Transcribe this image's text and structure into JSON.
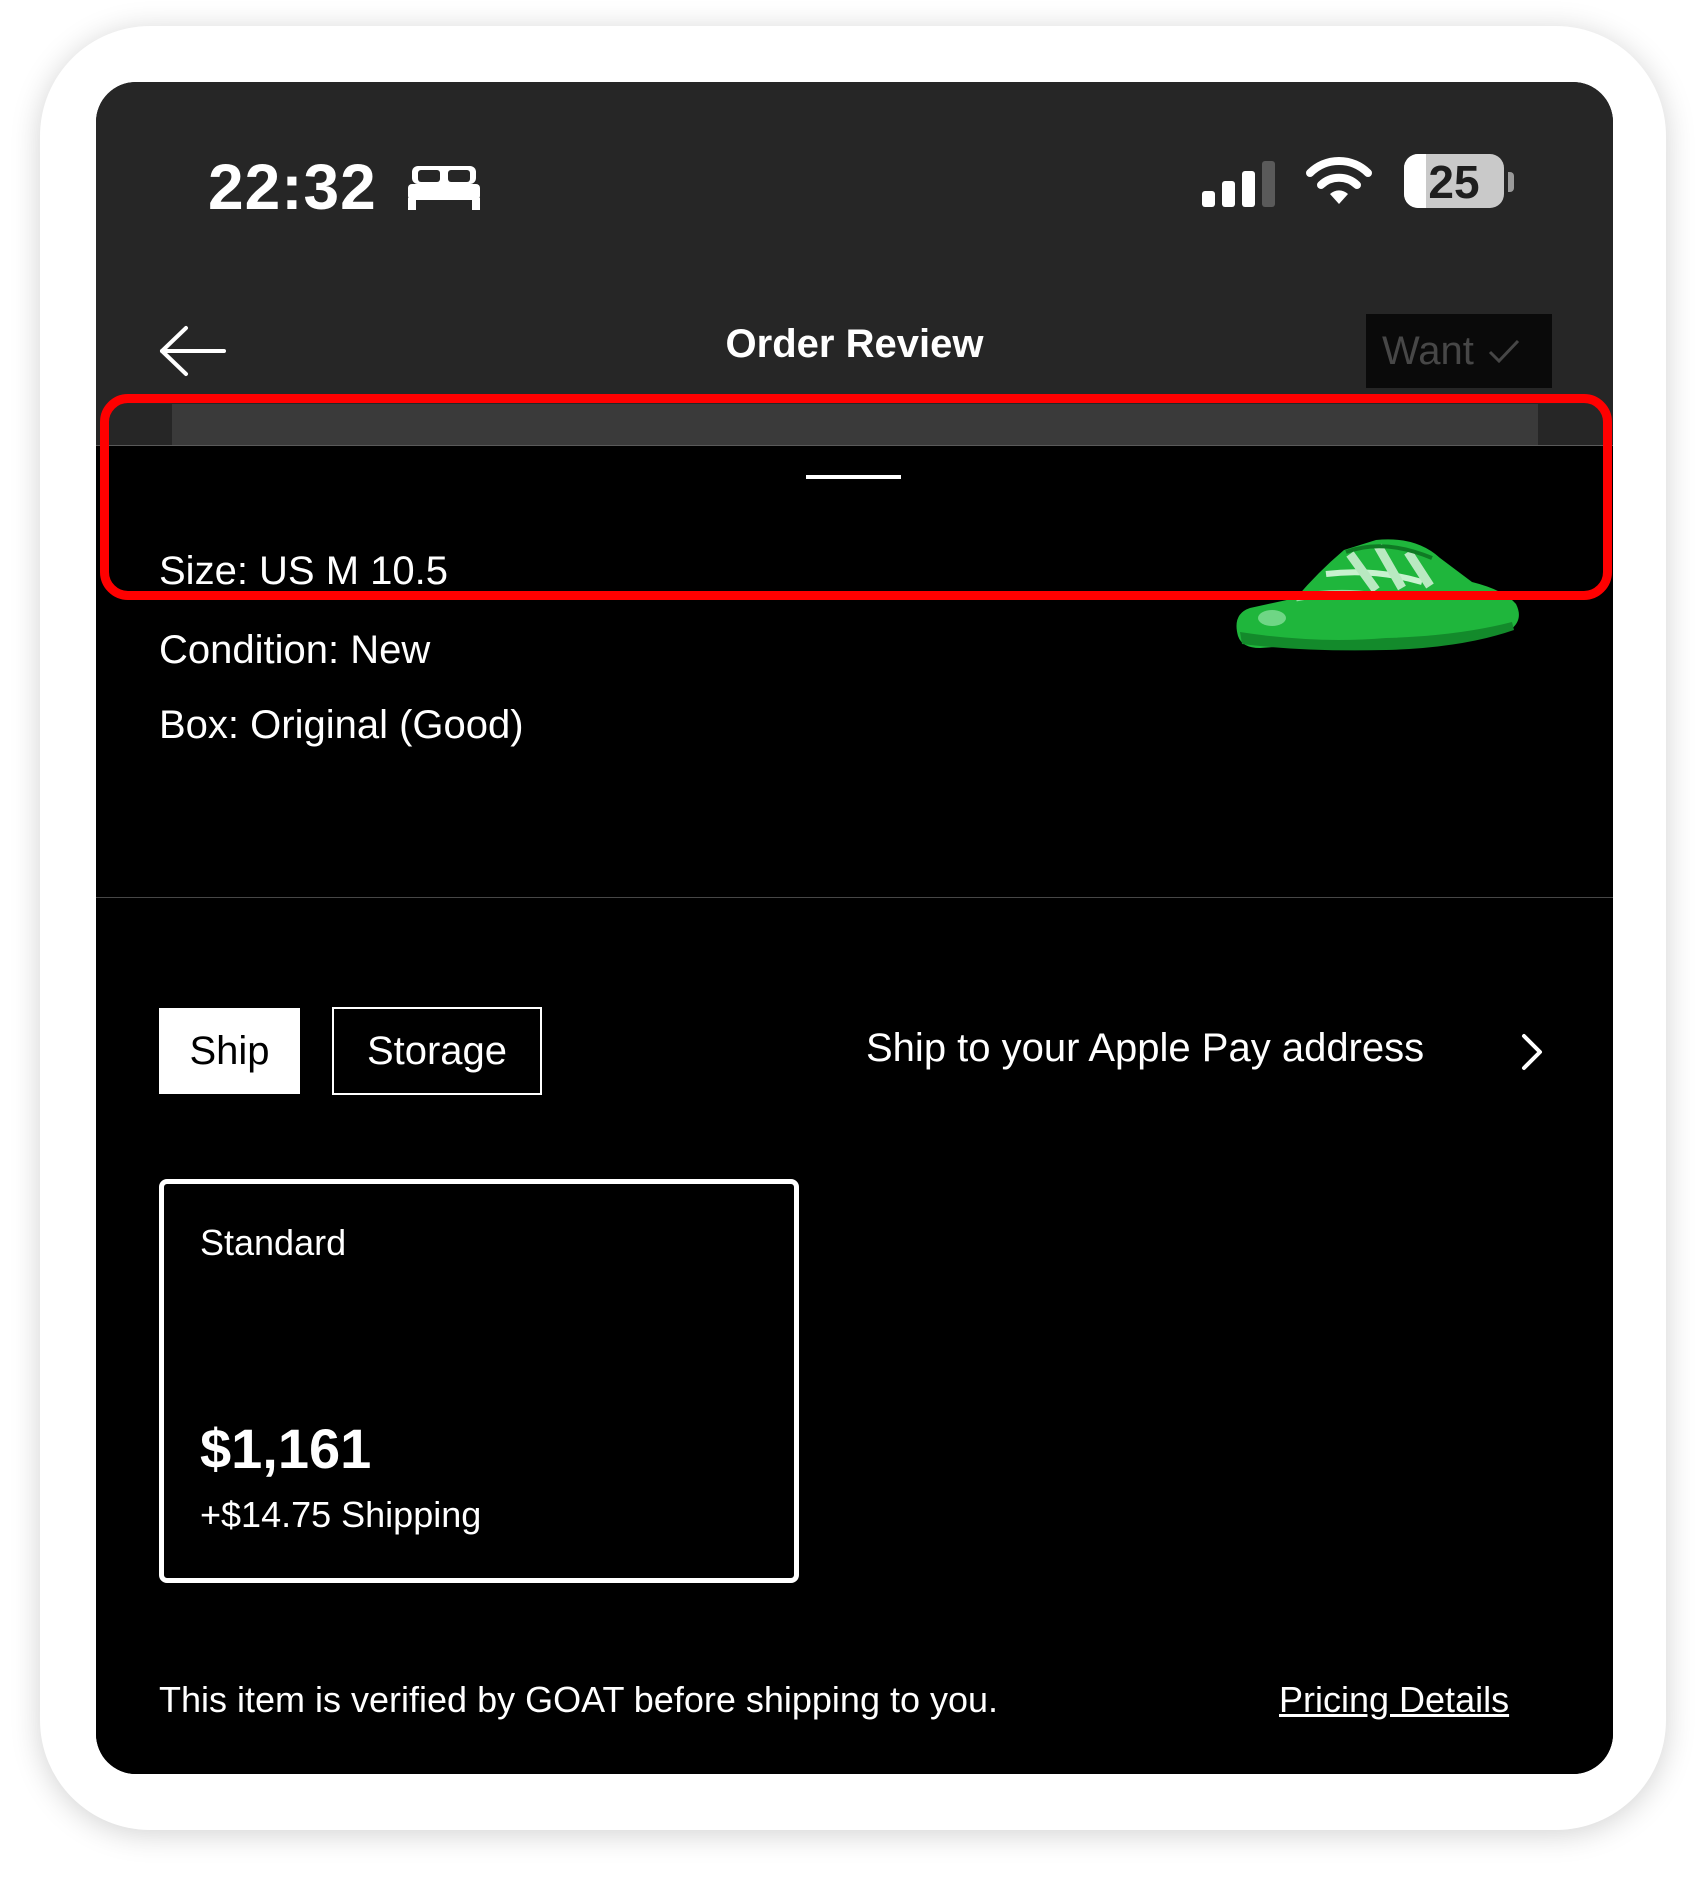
{
  "status_bar": {
    "time": "22:32",
    "battery": "25"
  },
  "header": {
    "title": "Order Review",
    "want_label": "Want"
  },
  "product": {
    "size": "Size: US M 10.5",
    "condition": "Condition: New",
    "box": "Box: Original (Good)"
  },
  "delivery": {
    "tabs": [
      "Ship",
      "Storage"
    ],
    "active_tab": "Ship",
    "address_label": "Ship to your Apple Pay address"
  },
  "shipping_option": {
    "name": "Standard",
    "price": "$1,161",
    "shipping": "+$14.75 Shipping"
  },
  "footer": {
    "verification": "This item is verified by GOAT before shipping to you.",
    "pricing_link": "Pricing Details"
  },
  "colors": {
    "background": "#000000",
    "header": "#262626",
    "text": "#ffffff",
    "shoe": "#1fb63c",
    "annotation": "#ff0000"
  }
}
